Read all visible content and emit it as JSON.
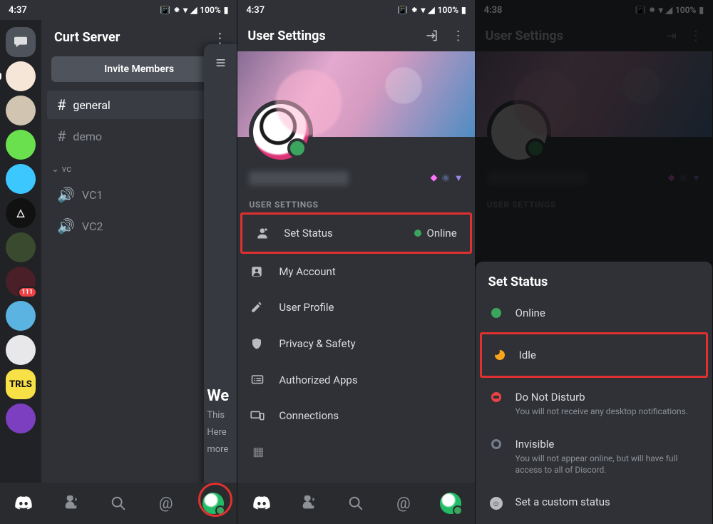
{
  "statusbar": {
    "s1_time": "4:37",
    "s2_time": "4:37",
    "s3_time": "4:38",
    "signal_icon": "signal-full",
    "battery_pct": "100%"
  },
  "screen1": {
    "server_name": "Curt Server",
    "invite_label": "Invite Members",
    "channels_text": [
      {
        "name": "general",
        "selected": true
      },
      {
        "name": "demo",
        "selected": false
      }
    ],
    "vc_category": "vc",
    "vc_channels": [
      "VC1",
      "VC2"
    ],
    "server_list_count": 12,
    "badge_count": "111",
    "peek": {
      "welcome_title": "We",
      "line1": "This",
      "line2": "Here",
      "line3": "more"
    },
    "tabs": [
      "discord",
      "friends",
      "search",
      "mentions",
      "profile"
    ]
  },
  "screen2": {
    "title": "User Settings",
    "section_label": "USER SETTINGS",
    "items": [
      {
        "icon": "status",
        "label": "Set Status",
        "rhs_status": "Online",
        "highlighted": true
      },
      {
        "icon": "account",
        "label": "My Account"
      },
      {
        "icon": "pencil",
        "label": "User Profile"
      },
      {
        "icon": "shield",
        "label": "Privacy & Safety"
      },
      {
        "icon": "apps",
        "label": "Authorized Apps"
      },
      {
        "icon": "devices",
        "label": "Connections"
      }
    ]
  },
  "screen3": {
    "title": "User Settings",
    "section_label": "USER SETTINGS",
    "sheet_title": "Set Status",
    "options": [
      {
        "key": "online",
        "title": "Online",
        "desc": ""
      },
      {
        "key": "idle",
        "title": "Idle",
        "desc": "",
        "highlighted": true
      },
      {
        "key": "dnd",
        "title": "Do Not Disturb",
        "desc": "You will not receive any desktop notifications."
      },
      {
        "key": "invisible",
        "title": "Invisible",
        "desc": "You will not appear online, but will have full access to all of Discord."
      },
      {
        "key": "custom",
        "title": "Set a custom status",
        "desc": ""
      }
    ]
  }
}
